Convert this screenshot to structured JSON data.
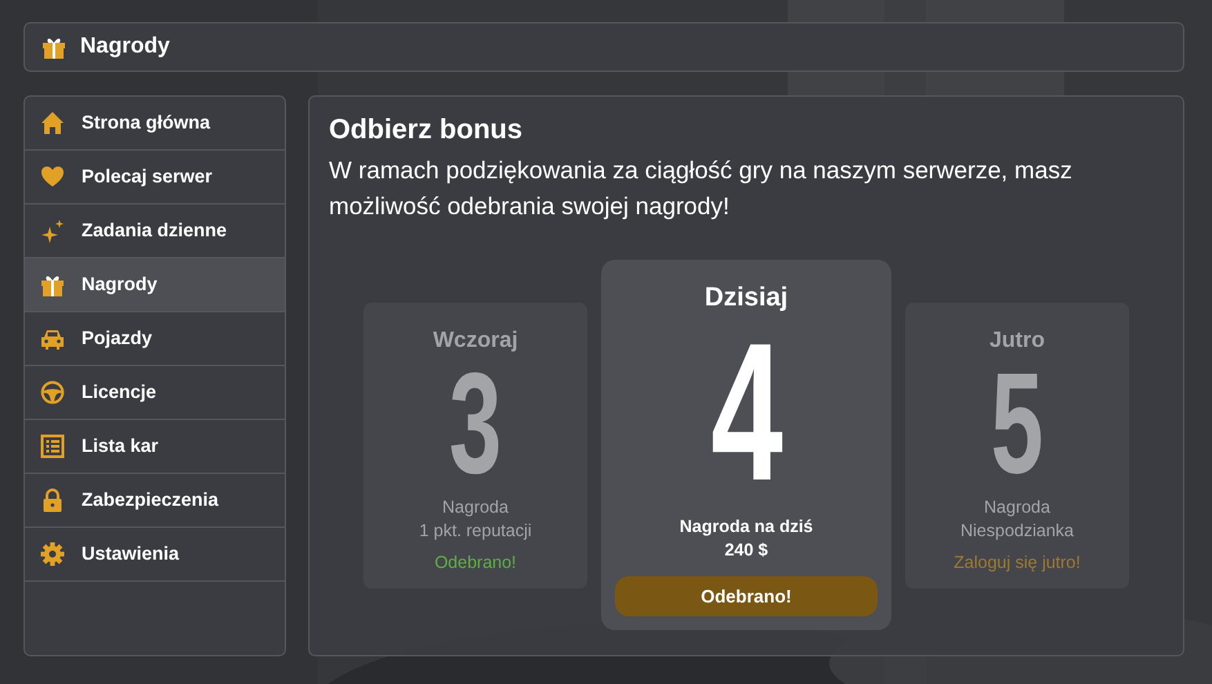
{
  "header": {
    "title": "Nagrody"
  },
  "sidebar": {
    "items": [
      {
        "label": "Strona główna",
        "selected": false
      },
      {
        "label": "Polecaj serwer",
        "selected": false
      },
      {
        "label": "Zadania dzienne",
        "selected": false
      },
      {
        "label": "Nagrody",
        "selected": true
      },
      {
        "label": "Pojazdy",
        "selected": false
      },
      {
        "label": "Licencje",
        "selected": false
      },
      {
        "label": "Lista kar",
        "selected": false
      },
      {
        "label": "Zabezpieczenia",
        "selected": false
      },
      {
        "label": "Ustawienia",
        "selected": false
      }
    ]
  },
  "main": {
    "title": "Odbierz bonus",
    "text": "W ramach podziękowania za ciągłość gry na naszym serwerze, masz możliwość odebrania swojej nagrody!",
    "days": [
      {
        "kind": "past",
        "label": "Wczoraj",
        "number": "3",
        "reward": [
          "Nagroda",
          "1 pkt. reputacji"
        ],
        "status": "Odebrano!"
      },
      {
        "kind": "today",
        "label": "Dzisiaj",
        "number": "4",
        "reward": [
          "Nagroda na dziś",
          "240 $"
        ],
        "status": "Odebrano!"
      },
      {
        "kind": "future",
        "label": "Jutro",
        "number": "5",
        "reward": [
          "Nagroda",
          "Niespodzianka"
        ],
        "status": "Zaloguj się jutro!"
      }
    ]
  }
}
